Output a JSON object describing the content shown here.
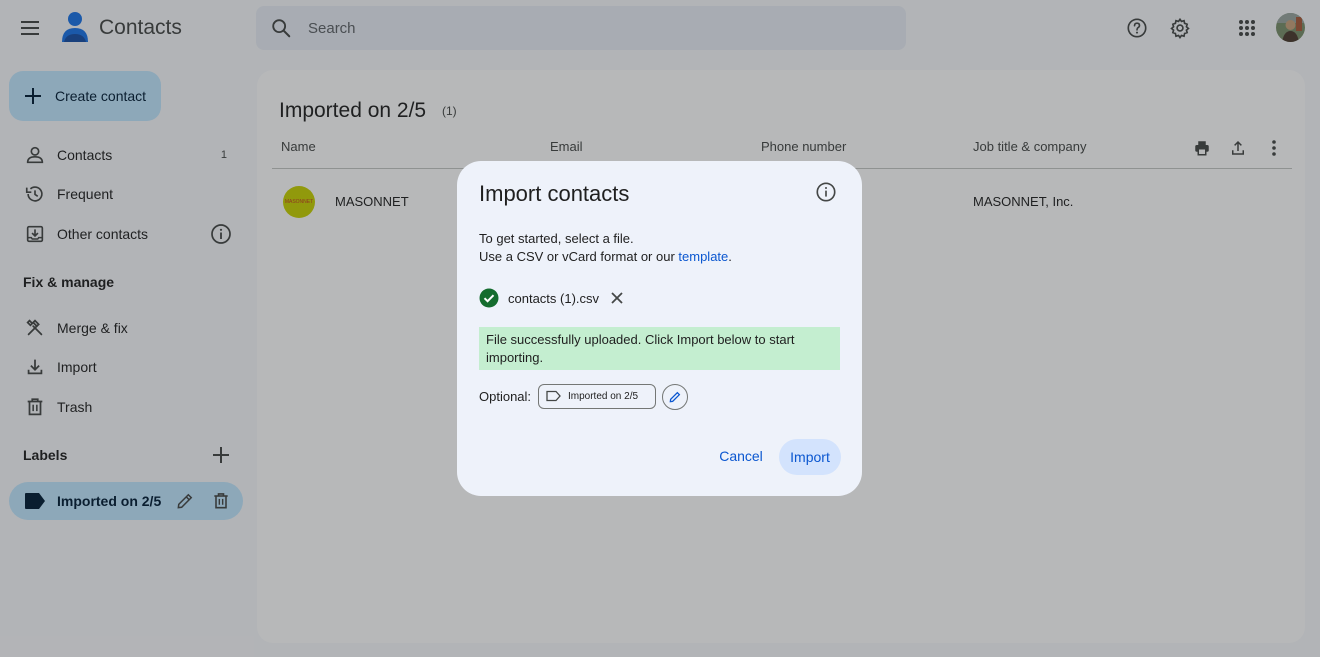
{
  "app": {
    "title": "Contacts"
  },
  "search": {
    "placeholder": "Search"
  },
  "header": {
    "icons": [
      "menu-icon",
      "contacts-logo",
      "help-icon",
      "settings-icon",
      "apps-grid-icon",
      "avatar"
    ]
  },
  "sidebar": {
    "create_label": "Create contact",
    "items": [
      {
        "label": "Contacts",
        "count": "1",
        "icon": "person-icon"
      },
      {
        "label": "Frequent",
        "icon": "history-icon"
      },
      {
        "label": "Other contacts",
        "icon": "archive-icon"
      }
    ],
    "fix_manage_header": "Fix & manage",
    "fix_items": [
      {
        "label": "Merge & fix",
        "icon": "tools-icon"
      },
      {
        "label": "Import",
        "icon": "download-icon"
      },
      {
        "label": "Trash",
        "icon": "trash-icon"
      }
    ],
    "labels_header": "Labels",
    "labels": [
      {
        "label": "Imported on 2/5",
        "icon": "label-icon"
      }
    ]
  },
  "main": {
    "title": "Imported on 2/5",
    "count": "(1)",
    "columns": [
      "Name",
      "Email",
      "Phone number",
      "Job title & company"
    ],
    "rows": [
      {
        "name": "MASONNET",
        "avatar_text": "MASONNET",
        "company": "MASONNET, Inc."
      }
    ]
  },
  "dialog": {
    "title": "Import contacts",
    "line1": "To get started, select a file.",
    "line2_prefix": "Use a CSV or vCard format or our ",
    "line2_link": "template",
    "line2_suffix": ".",
    "file_name": "contacts (1).csv",
    "success_message": "File successfully uploaded. Click Import below to start importing.",
    "optional_label": "Optional:",
    "chip_label": "Imported on 2/5",
    "cancel_label": "Cancel",
    "import_label": "Import"
  },
  "colors": {
    "accent": "#0b57d0",
    "create_button_bg": "#c2e7ff",
    "success_bg": "#c4eed0",
    "success_icon": "#146c2e",
    "dialog_bg": "#eef2fa",
    "avatar_bg": "#c8d200"
  }
}
